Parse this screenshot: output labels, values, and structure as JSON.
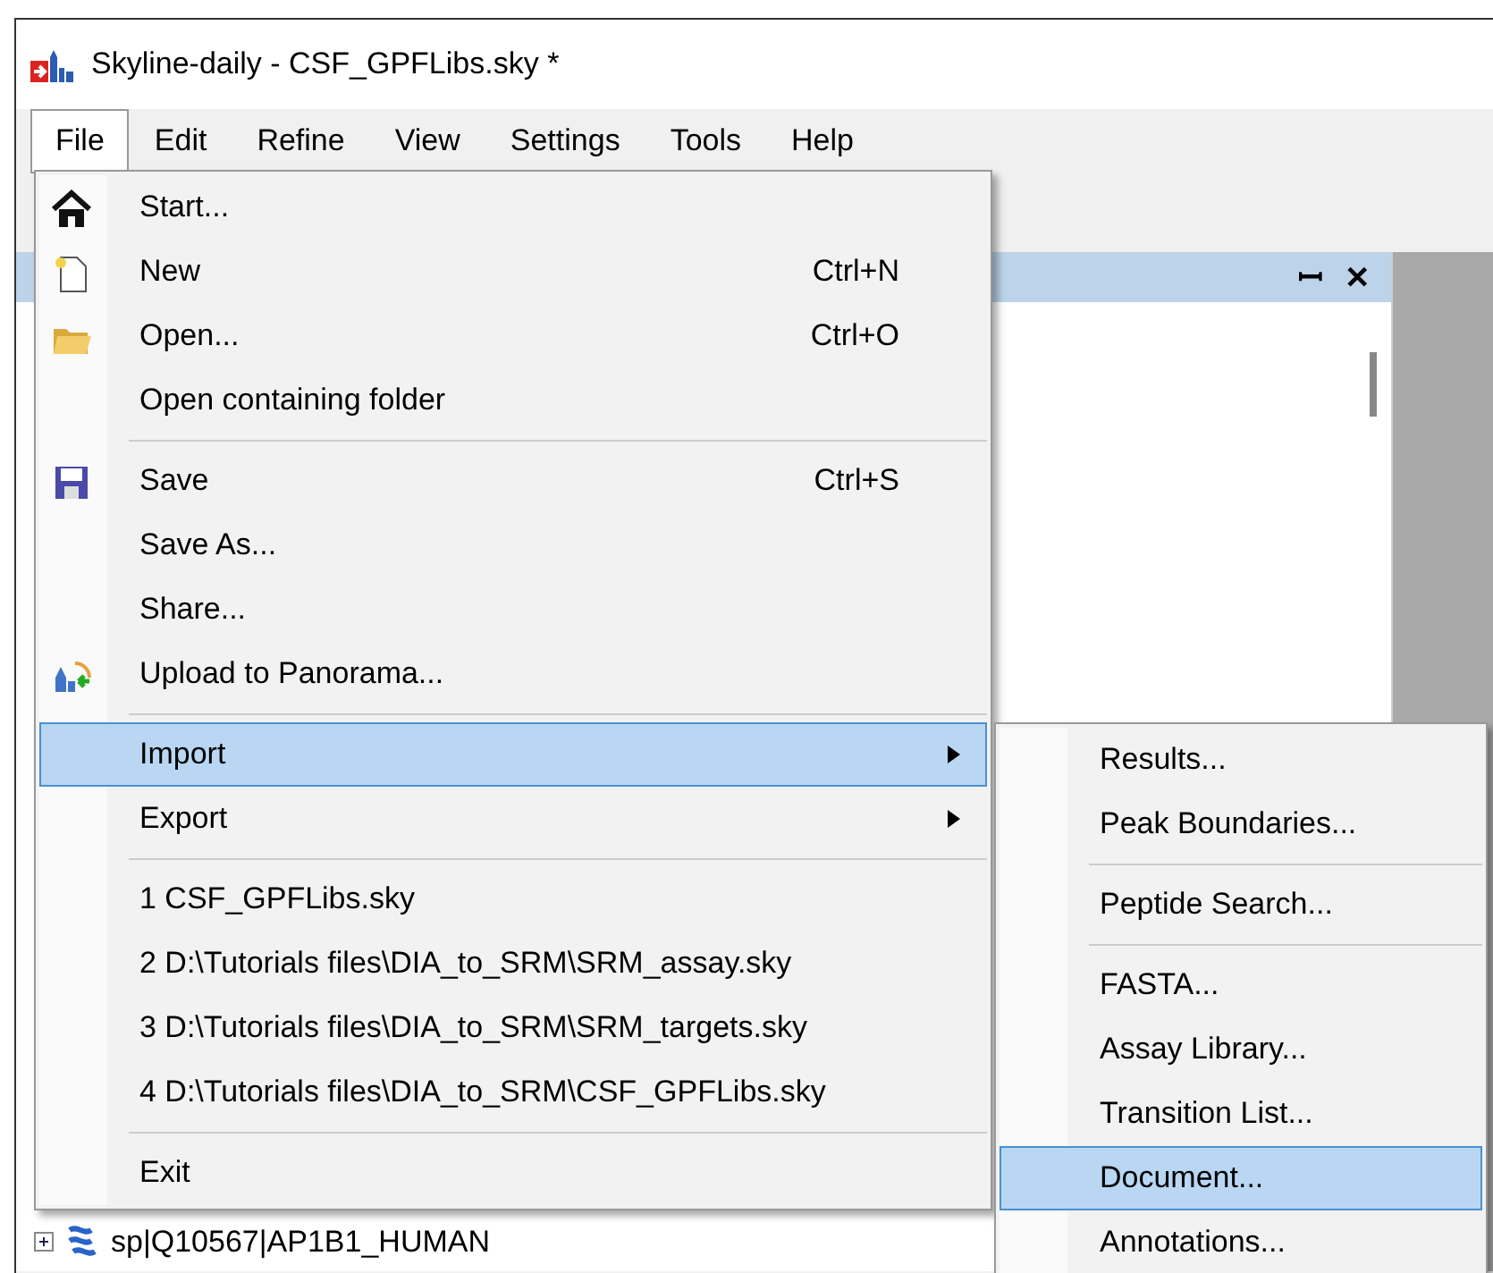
{
  "window": {
    "title": "Skyline-daily - CSF_GPFLibs.sky *"
  },
  "menubar": [
    {
      "label": "File",
      "selected": true
    },
    {
      "label": "Edit",
      "selected": false
    },
    {
      "label": "Refine",
      "selected": false
    },
    {
      "label": "View",
      "selected": false
    },
    {
      "label": "Settings",
      "selected": false
    },
    {
      "label": "Tools",
      "selected": false
    },
    {
      "label": "Help",
      "selected": false
    }
  ],
  "panel": {
    "pin": "ꟷ",
    "close": "✕"
  },
  "tree": [
    {
      "label": "sp|Q10567|AP1B1_HUMAN",
      "expanded": false
    }
  ],
  "file_menu": [
    {
      "kind": "item",
      "label": "Start...",
      "selected": false
    },
    {
      "kind": "item",
      "label": "New",
      "shortcut": "Ctrl+N",
      "selected": false
    },
    {
      "kind": "item",
      "label": "Open...",
      "shortcut": "Ctrl+O",
      "selected": false
    },
    {
      "kind": "item",
      "label": "Open containing folder",
      "selected": false
    },
    {
      "kind": "separator"
    },
    {
      "kind": "item",
      "label": "Save",
      "shortcut": "Ctrl+S",
      "selected": false
    },
    {
      "kind": "item",
      "label": "Save As...",
      "selected": false
    },
    {
      "kind": "item",
      "label": "Share...",
      "selected": false
    },
    {
      "kind": "item",
      "label": "Upload to Panorama...",
      "selected": false
    },
    {
      "kind": "separator"
    },
    {
      "kind": "item",
      "label": "Import",
      "submenu": true,
      "selected": true
    },
    {
      "kind": "item",
      "label": "Export",
      "submenu": true,
      "selected": false
    },
    {
      "kind": "separator"
    },
    {
      "kind": "item",
      "label": "1 CSF_GPFLibs.sky",
      "selected": false
    },
    {
      "kind": "item",
      "label": "2 D:\\Tutorials files\\DIA_to_SRM\\SRM_assay.sky",
      "selected": false
    },
    {
      "kind": "item",
      "label": "3 D:\\Tutorials files\\DIA_to_SRM\\SRM_targets.sky",
      "selected": false
    },
    {
      "kind": "item",
      "label": "4 D:\\Tutorials files\\DIA_to_SRM\\CSF_GPFLibs.sky",
      "selected": false
    },
    {
      "kind": "separator"
    },
    {
      "kind": "item",
      "label": "Exit",
      "selected": false
    }
  ],
  "import_menu": [
    {
      "kind": "item",
      "label": "Results...",
      "selected": false
    },
    {
      "kind": "item",
      "label": "Peak Boundaries...",
      "selected": false
    },
    {
      "kind": "separator"
    },
    {
      "kind": "item",
      "label": "Peptide Search...",
      "selected": false
    },
    {
      "kind": "separator"
    },
    {
      "kind": "item",
      "label": "FASTA...",
      "selected": false
    },
    {
      "kind": "item",
      "label": "Assay Library...",
      "selected": false
    },
    {
      "kind": "item",
      "label": "Transition List...",
      "selected": false
    },
    {
      "kind": "item",
      "label": "Document...",
      "selected": true
    },
    {
      "kind": "item",
      "label": "Annotations...",
      "selected": false
    }
  ]
}
